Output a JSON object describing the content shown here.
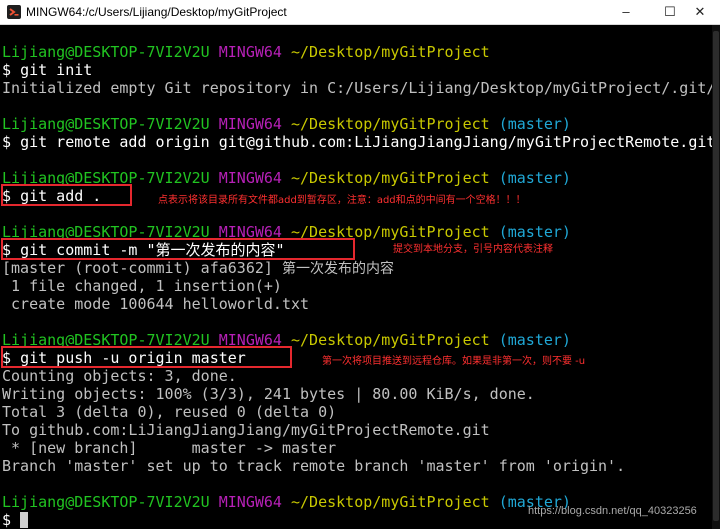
{
  "window": {
    "title": "MINGW64:/c/Users/Lijiang/Desktop/myGitProject",
    "minimize_glyph": "–",
    "maximize_glyph": "☐",
    "close_glyph": "✕"
  },
  "prompt": {
    "user": "Lijiang@DESKTOP-7VI2V2U",
    "shell": "MINGW64",
    "path": "~/Desktop/myGitProject",
    "branch": "(master)",
    "symbol": "$"
  },
  "lines": {
    "cmd_init": "git init",
    "out_init": "Initialized empty Git repository in C:/Users/Lijiang/Desktop/myGitProject/.git/",
    "cmd_remote": "git remote add origin git@github.com:LiJiangJiangJiang/myGitProjectRemote.git",
    "cmd_add": "git add .",
    "cmd_commit": "git commit -m \"第一次发布的内容\"",
    "out_commit_1a": "[master (root-commit) afa6362] ",
    "out_commit_1b": "第一次发布的内容",
    "out_commit_2": " 1 file changed, 1 insertion(+)",
    "out_commit_3": " create mode 100644 helloworld.txt",
    "cmd_push": "git push -u origin master",
    "out_push_1": "Counting objects: 3, done.",
    "out_push_2": "Writing objects: 100% (3/3), 241 bytes | 80.00 KiB/s, done.",
    "out_push_3": "Total 3 (delta 0), reused 0 (delta 0)",
    "out_push_4": "To github.com:LiJiangJiangJiang/myGitProjectRemote.git",
    "out_push_5": " * [new branch]      master -> master",
    "out_push_6": "Branch 'master' set up to track remote branch 'master' from 'origin'."
  },
  "annotations": {
    "add": "点表示将该目录所有文件都add到暂存区，注意：add和点的中间有一个空格！！！",
    "commit": "提交到本地分支，引号内容代表注释",
    "push": "第一次将项目推送到远程仓库。如果是非第一次，则不要 -u"
  },
  "watermark": "https://blog.csdn.net/qq_40323256",
  "colors": {
    "terminal_bg": "#000000",
    "text": "#c0c0c0",
    "user_host": "#21c421",
    "shell": "#b620b6",
    "path": "#c8c800",
    "branch": "#20a8d6",
    "annotation": "#e5282e"
  }
}
